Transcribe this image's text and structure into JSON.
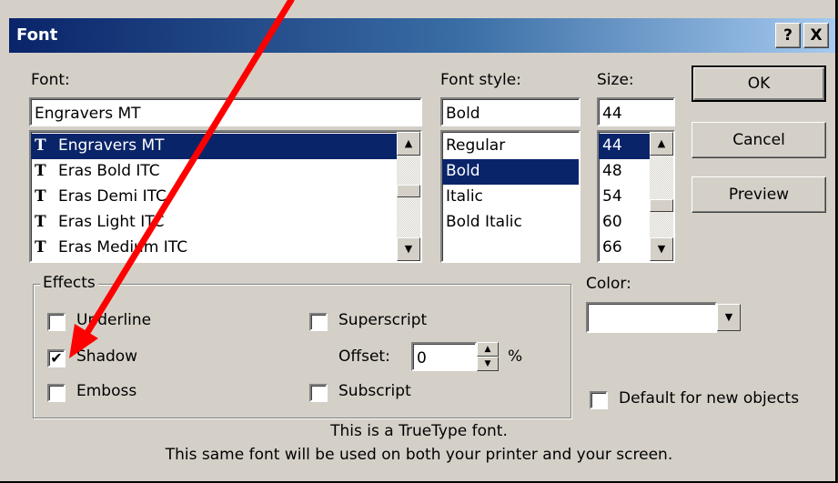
{
  "window": {
    "title": "Font",
    "help_label": "?",
    "close_label": "X"
  },
  "font": {
    "label": "Font:",
    "value": "Engravers MT",
    "list": [
      "Engravers MT",
      "Eras Bold ITC",
      "Eras Demi ITC",
      "Eras Light ITC",
      "Eras Medium ITC"
    ],
    "selected_index": 0,
    "type_icon": "truetype-icon"
  },
  "font_style": {
    "label": "Font style:",
    "value": "Bold",
    "list": [
      "Regular",
      "Bold",
      "Italic",
      "Bold Italic"
    ],
    "selected_index": 1
  },
  "size": {
    "label": "Size:",
    "value": "44",
    "list": [
      "44",
      "48",
      "54",
      "60",
      "66"
    ],
    "selected_index": 0
  },
  "buttons": {
    "ok": "OK",
    "cancel": "Cancel",
    "preview": "Preview"
  },
  "effects": {
    "label": "Effects",
    "underline": {
      "label": "Underline",
      "checked": false
    },
    "shadow": {
      "label": "Shadow",
      "checked": true
    },
    "emboss": {
      "label": "Emboss",
      "checked": false
    },
    "superscript": {
      "label": "Superscript",
      "checked": false
    },
    "subscript": {
      "label": "Subscript",
      "checked": false
    },
    "offset_label": "Offset:",
    "offset_value": "0",
    "offset_unit": "%"
  },
  "color": {
    "label": "Color:",
    "value": "#ffffff"
  },
  "default_for_new_objects": {
    "label": "Default for new objects",
    "checked": false
  },
  "info_line1": "This is a TrueType font.",
  "info_line2": "This same font will be used on both your printer and your screen.",
  "annotation_color": "#ff0000"
}
